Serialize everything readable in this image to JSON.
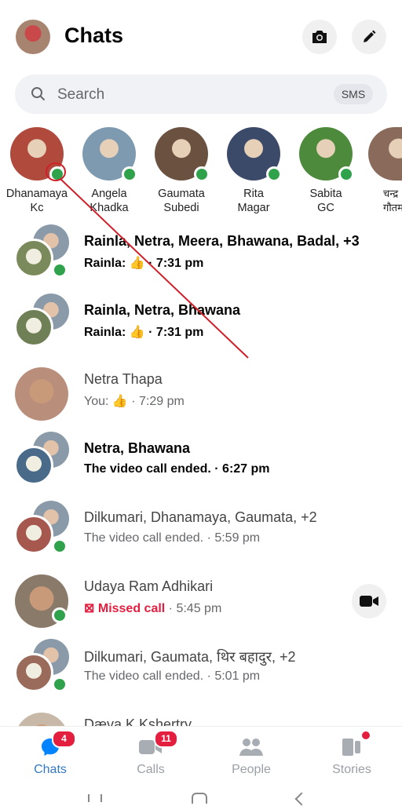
{
  "header": {
    "title": "Chats",
    "camera_icon": "camera-icon",
    "compose_icon": "pencil-icon"
  },
  "search": {
    "placeholder": "Search",
    "sms_label": "SMS"
  },
  "stories": [
    {
      "name1": "Dhanamaya",
      "name2": "Kc",
      "color": "#b04a3c",
      "online": true
    },
    {
      "name1": "Angela",
      "name2": "Khadka",
      "color": "#7e9ab0",
      "online": true
    },
    {
      "name1": "Gaumata",
      "name2": "Subedi",
      "color": "#6b5140",
      "online": true
    },
    {
      "name1": "Rita",
      "name2": "Magar",
      "color": "#3c4a6a",
      "online": true
    },
    {
      "name1": "Sabita",
      "name2": "GC",
      "color": "#4d8a3c",
      "online": true
    },
    {
      "name1": "चन्द्र",
      "name2": "गौतम",
      "color": "#8a6a5a",
      "online": false
    }
  ],
  "chats": [
    {
      "name": "Rainla, Netra, Meera, Bhawana, Badal, +3",
      "preview": "Rainla: 👍 · 7:31 pm",
      "unread": true,
      "group": true,
      "online": true
    },
    {
      "name": "Rainla, Netra, Bhawana",
      "preview": "Rainla: 👍 · 7:31 pm",
      "unread": true,
      "group": true,
      "online": false
    },
    {
      "name": "Netra Thapa",
      "preview": "You: 👍 · 7:29 pm",
      "unread": false,
      "group": false,
      "online": false
    },
    {
      "name": "Netra, Bhawana",
      "preview": "The video call ended. · 6:27 pm",
      "unread": true,
      "group": true,
      "online": false
    },
    {
      "name": "Dilkumari, Dhanamaya, Gaumata, +2",
      "preview": "The video call ended. · 5:59 pm",
      "unread": false,
      "group": true,
      "online": true
    },
    {
      "name": "Udaya Ram Adhikari",
      "missed": "Missed call",
      "preview": " · 5:45 pm",
      "unread": false,
      "group": false,
      "online": true,
      "video_button": true
    },
    {
      "name": "Dilkumari, Gaumata, थिर बहादुर, +2",
      "preview": "The video call ended. · 5:01 pm",
      "unread": false,
      "group": true,
      "online": true
    },
    {
      "name": "Dæva K Kshertry",
      "preview": "",
      "unread": false,
      "group": false,
      "online": false
    }
  ],
  "nav": [
    {
      "label": "Chats",
      "badge": "4",
      "active": true
    },
    {
      "label": "Calls",
      "badge": "11",
      "active": false
    },
    {
      "label": "People",
      "badge": "",
      "active": false
    },
    {
      "label": "Stories",
      "badge": "",
      "dot": true,
      "active": false
    }
  ],
  "colors": {
    "accent": "#0084ff",
    "online": "#31a24c",
    "badge": "#e41e3f",
    "annotation": "#d0202a"
  }
}
